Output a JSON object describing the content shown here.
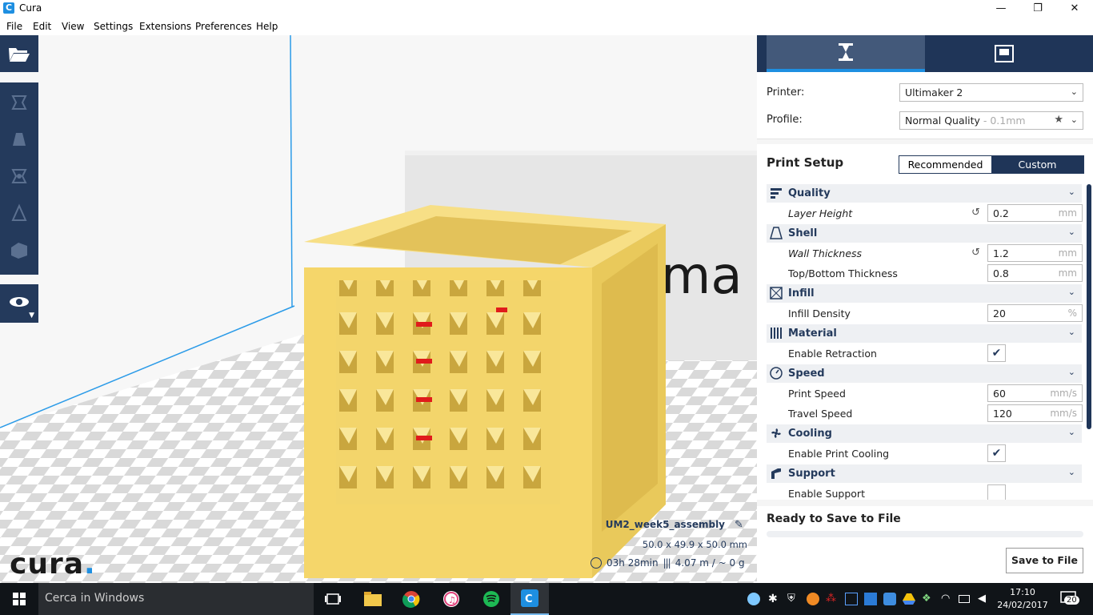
{
  "window": {
    "title": "Cura",
    "minimize": "—",
    "maximize": "❐",
    "close": "✕"
  },
  "menu": [
    "File",
    "Edit",
    "View",
    "Settings",
    "Extensions",
    "Preferences",
    "Help"
  ],
  "viewport": {
    "logo_text": "cura",
    "logo_dot": ".",
    "backplate_text": "ma",
    "object_name": "UM2_week5_assembly",
    "object_dims": "50.0 x 49.9 x 50.0 mm",
    "print_time": "03h 28min",
    "material_usage": "4.07 m / ~ 0 g"
  },
  "panel": {
    "printer_label": "Printer:",
    "printer_value": "Ultimaker 2",
    "profile_label": "Profile:",
    "profile_value": "Normal Quality",
    "profile_suffix": " - 0.1mm",
    "setup_title": "Print Setup",
    "mode_recommended": "Recommended",
    "mode_custom": "Custom",
    "categories": {
      "quality": "Quality",
      "shell": "Shell",
      "infill": "Infill",
      "material": "Material",
      "speed": "Speed",
      "cooling": "Cooling",
      "support": "Support"
    },
    "settings": {
      "layer_height": {
        "label": "Layer Height",
        "value": "0.2",
        "unit": "mm"
      },
      "wall_thickness": {
        "label": "Wall Thickness",
        "value": "1.2",
        "unit": "mm"
      },
      "top_bottom": {
        "label": "Top/Bottom Thickness",
        "value": "0.8",
        "unit": "mm"
      },
      "infill_density": {
        "label": "Infill Density",
        "value": "20",
        "unit": "%"
      },
      "enable_retraction": {
        "label": "Enable Retraction",
        "checked": "✔"
      },
      "print_speed": {
        "label": "Print Speed",
        "value": "60",
        "unit": "mm/s"
      },
      "travel_speed": {
        "label": "Travel Speed",
        "value": "120",
        "unit": "mm/s"
      },
      "print_cooling": {
        "label": "Enable Print Cooling",
        "checked": "✔"
      },
      "enable_support": {
        "label": "Enable Support",
        "checked": ""
      }
    },
    "save_title": "Ready to Save to File",
    "save_button": "Save to File"
  },
  "taskbar": {
    "search_placeholder": "Cerca in Windows",
    "time": "17:10",
    "date": "24/02/2017",
    "notifications": "20"
  },
  "colors": {
    "accent": "#1e8fe1",
    "dark_blue": "#1f3558",
    "model_yellow": "#f5d66a"
  }
}
